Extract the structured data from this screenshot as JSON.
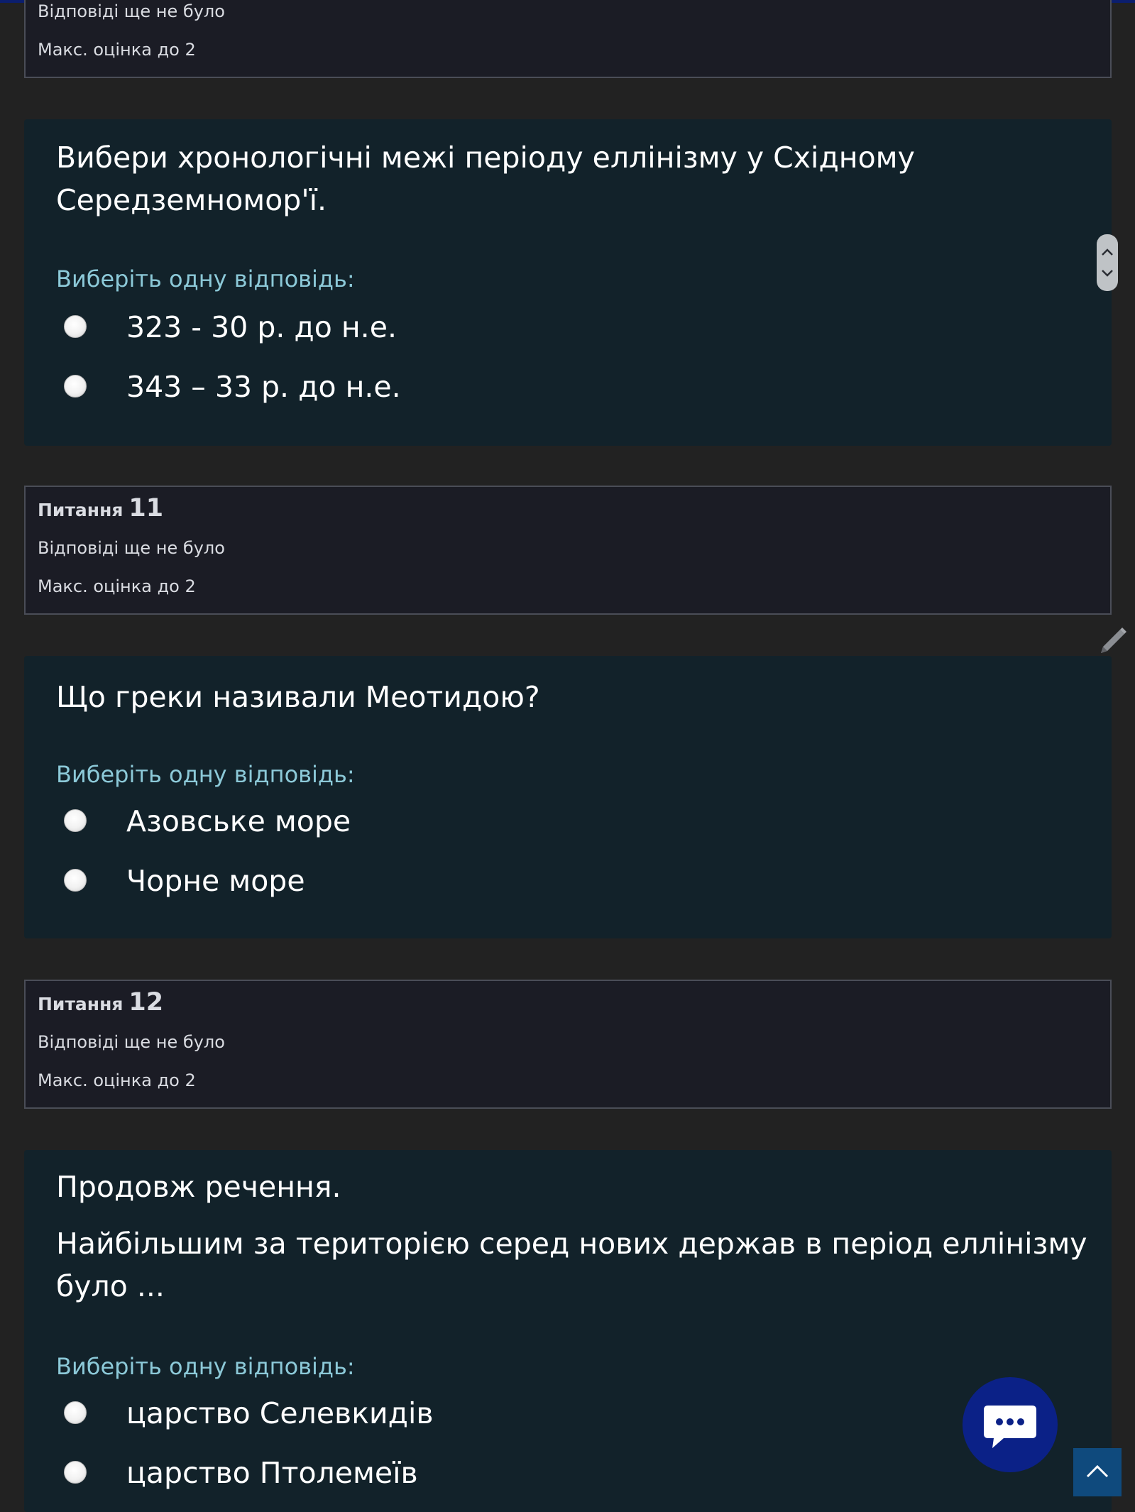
{
  "info_top": {
    "status": "Відповіді ще не було",
    "max_grade": "Макс. оцінка до 2"
  },
  "q10": {
    "text_line1": "Вибери хронологічні межі періоду еллінізму у Східному",
    "text_line2": "Середземномор'ї.",
    "prompt": "Виберіть одну відповідь:",
    "options": [
      "323 - 30 р. до н.е.",
      "343 – 33 р. до н.е."
    ]
  },
  "info11": {
    "word": "Питання",
    "number": "11",
    "status": "Відповіді ще не було",
    "max_grade": "Макс. оцінка до 2"
  },
  "q11": {
    "text_line1": "Що греки називали Меотидою?",
    "prompt": "Виберіть одну відповідь:",
    "options": [
      "Азовське море",
      "Чорне море"
    ]
  },
  "info12": {
    "word": "Питання",
    "number": "12",
    "status": "Відповіді ще не було",
    "max_grade": "Макс. оцінка до 2"
  },
  "q12": {
    "text_line1": "Продовж речення.",
    "text_line2": "Найбільшим за територією серед нових держав в період еллінізму",
    "text_line3": "було ...",
    "prompt": "Виберіть одну відповідь:",
    "options": [
      "царство Селевкидів",
      "царство Птолемеїв"
    ]
  },
  "icons": {
    "scroll": "scroll-up-down-icon",
    "edit": "pencil-icon",
    "chat": "chat-bubble-icon",
    "top": "chevron-up-icon"
  },
  "colors": {
    "page_bg": "#222222",
    "card_bg": "#12222a",
    "info_bg": "#1b1c25",
    "prompt": "#8cc9d8",
    "chat_button": "#0b2187",
    "top_button": "#0f4a7d"
  }
}
